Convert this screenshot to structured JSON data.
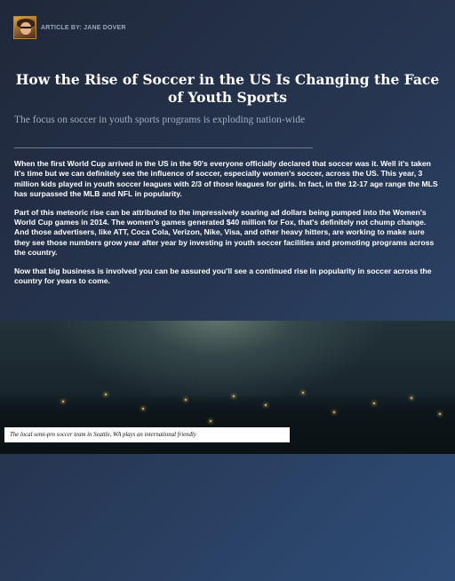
{
  "byline": {
    "label": "ARTICLE BY: JANE DOVER",
    "avatar_icon": "author-portrait"
  },
  "article": {
    "title": "How the Rise of Soccer in the US Is Changing the Face of Youth Sports",
    "subtitle": "The focus on soccer in youth sports programs is exploding nation-wide",
    "paragraphs": [
      "When the first World Cup arrived in the US in the 90's everyone officially declared that soccer was it. Well it's taken it's time but we can definitely see the influence of soccer, especially women's soccer, across the US. This year, 3 million kids played in youth soccer leagues with 2/3 of those leagues for girls. In fact, in the 12-17 age range the MLS has surpassed the MLB and NFL in popularity.",
      "Part of this meteoric rise can be attributed to the impressively soaring ad dollars being pumped into the Women's World Cup games in 2014. The women's games generated $40 million for Fox, that's definitely not chump change. And those advertisers, like ATT, Coca Cola, Verizon, Nike, Visa, and other heavy hitters, are working to make sure they see those numbers grow year after year by investing in youth soccer facilities and promoting programs across the country.",
      "Now that big business is involved you can be assured you'll see a continued rise in popularity in soccer across the country for years to come."
    ]
  },
  "photo": {
    "caption": "The local semi-pro soccer team in Seattle, WA plays an international friendly"
  },
  "colors": {
    "background_start": "#20283a",
    "background_end": "#2e4d78",
    "subtitle": "#a4adbf",
    "byline": "#9aa7bd"
  }
}
